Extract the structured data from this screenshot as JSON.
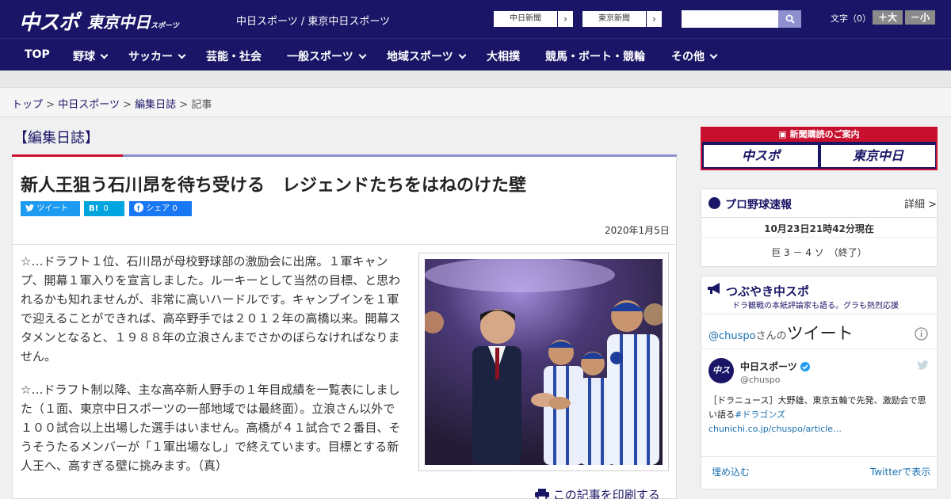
{
  "header": {
    "logo_primary": "中スポ",
    "logo_secondary": "東京中日",
    "logo_secondary_small": "スポーツ",
    "site_name": "中日スポーツ / 東京中日スポーツ",
    "ext_links": [
      {
        "label": "中日新聞",
        "arrow": "›"
      },
      {
        "label": "東京新聞",
        "arrow": "›"
      }
    ],
    "search": {
      "placeholder": "",
      "value": ""
    },
    "font_size_label": "文字（0）",
    "font_larger": "＋大",
    "font_smaller": "－小"
  },
  "nav": {
    "items": [
      {
        "label": "TOP",
        "dropdown": false
      },
      {
        "label": "野球",
        "dropdown": true
      },
      {
        "label": "サッカー",
        "dropdown": true
      },
      {
        "label": "芸能・社会",
        "dropdown": false
      },
      {
        "label": "一般スポーツ",
        "dropdown": true
      },
      {
        "label": "地域スポーツ",
        "dropdown": true
      },
      {
        "label": "大相撲",
        "dropdown": false
      },
      {
        "label": "競馬・ボート・競輪",
        "dropdown": false
      },
      {
        "label": "その他",
        "dropdown": true
      }
    ]
  },
  "breadcrumb": {
    "items": [
      "トップ",
      "中日スポーツ",
      "編集日誌"
    ],
    "separator": ">",
    "current": "記事"
  },
  "article": {
    "section_title": "【編集日誌】",
    "headline": "新人王狙う石川昂を待ち受ける　レジェンドたちをはねのけた壁",
    "share": {
      "tweet": "ツイート",
      "hatena_count": "0",
      "facebook_label": "シェア",
      "facebook_count": "0"
    },
    "date": "2020年1月5日",
    "paragraphs": [
      "☆…ドラフト１位、石川昂が母校野球部の激励会に出席。１軍キャンプ、開幕１軍入りを宣言しました。ルーキーとして当然の目標、と思われるかも知れませんが、非常に高いハードルです。キャンプインを１軍で迎えることができれば、高卒野手では２０１２年の高橋以来。開幕スタメンとなると、１９８８年の立浪さんまでさかのぼらなければなりません。",
      "☆…ドラフト制以降、主な高卒新人野手の１年目成績を一覧表にしました（１面、東京中日スポーツの一部地域では最終面）。立浪さん以外で１００試合以上出場した選手はいません。高橋が４１試合で２番目、そうそうたるメンバーが「１軍出場なし」で終えています。目標とする新人王へ、高すぎる壁に挑みます。（真）"
    ],
    "print_label": "この記事を印刷する"
  },
  "sidebar": {
    "promo": {
      "title": "新聞購読のご案内",
      "btn1": "中スポ",
      "btn2": "東京中日"
    },
    "baseball": {
      "title": "プロ野球速報",
      "detail": "詳細 >",
      "updated": "10月23日21時42分現在",
      "score": "巨 3 － 4 ソ　（終了）"
    },
    "tweets": {
      "title": "つぶやき中スポ",
      "subtitle": "ドラ観戦の本紙評論家も語る。グラも熱烈応援",
      "account_handle": "@chuspo",
      "account_suffix": "さんの",
      "account_tweets": "ツイート",
      "user_name": "中日スポーツ",
      "user_handle": "@chuspo",
      "tweet_text": "［ドラニュース］大野雄、東京五輪で先発、激励会で思い語る",
      "tweet_hashtag": "#ドラゴンズ",
      "tweet_link": "chunichi.co.jp/chuspo/article…",
      "embed": "埋め込む",
      "view_on": "Twitterで表示"
    }
  },
  "colors": {
    "brand_navy": "#1a1566",
    "accent_red": "#c8102e",
    "accent_lavender": "#8d8fcf",
    "twitter_blue": "#1d9bf0"
  }
}
